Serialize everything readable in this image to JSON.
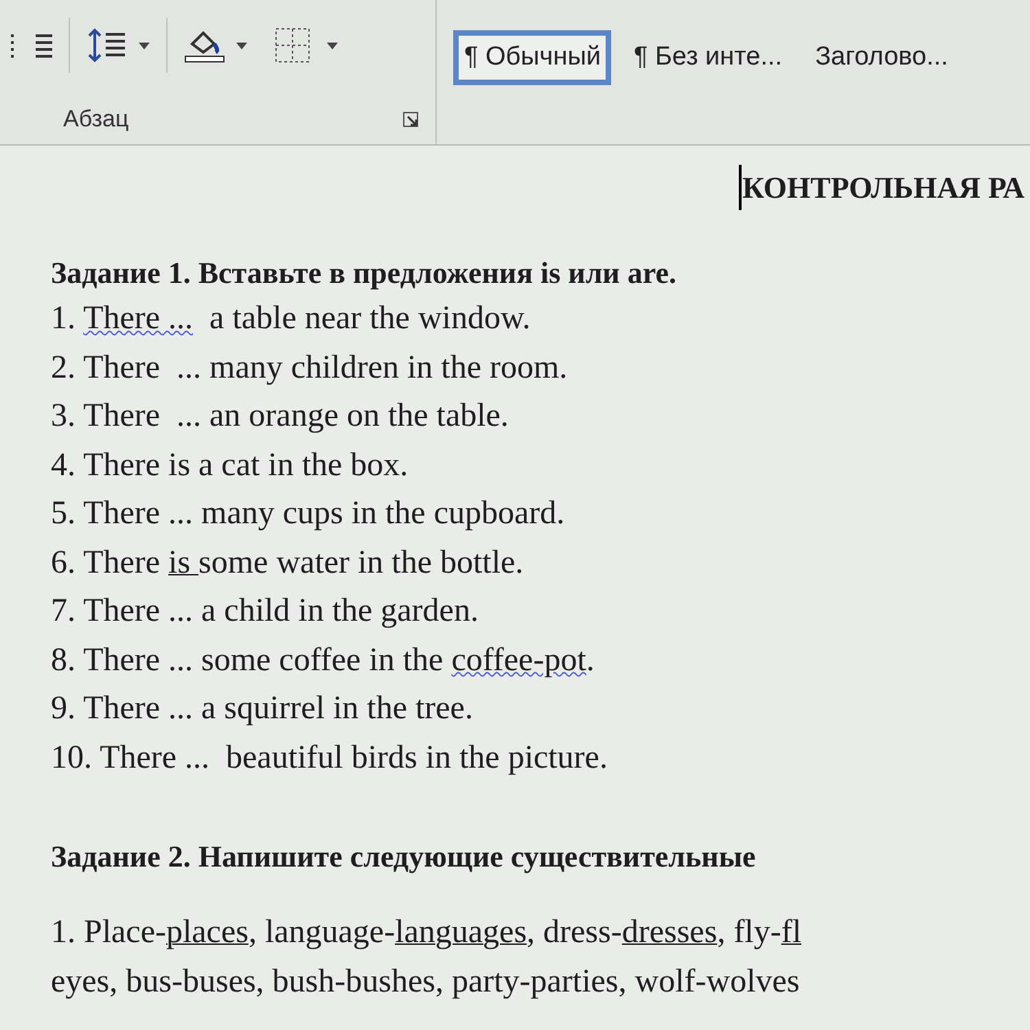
{
  "ribbon": {
    "paragraph_group": {
      "label": "Абзац"
    },
    "styles": [
      {
        "label": "¶ Обычный",
        "selected": true
      },
      {
        "label": "¶ Без инте...",
        "selected": false
      },
      {
        "label": "Заголово...",
        "selected": false
      }
    ]
  },
  "document": {
    "title": "КОНТРОЛЬНАЯ РА",
    "tasks": [
      {
        "heading": "Задание 1. Вставьте в предложения is или are.",
        "lines": [
          [
            {
              "text": "1. "
            },
            {
              "text": "There ...",
              "kind": "misspelled"
            },
            {
              "text": "  a table near the window."
            }
          ],
          [
            {
              "text": "2. There  ... many children in the room."
            }
          ],
          [
            {
              "text": "3. There  ... an orange on the table."
            }
          ],
          [
            {
              "text": "4. There is a cat in the box."
            }
          ],
          [
            {
              "text": "5. There ... many cups in the cupboard."
            }
          ],
          [
            {
              "text": "6. There "
            },
            {
              "text": "is ",
              "kind": "underlined"
            },
            {
              "text": "some water in the bottle."
            }
          ],
          [
            {
              "text": "7. There ... a child in the garden."
            }
          ],
          [
            {
              "text": "8. There ... some coffee in the "
            },
            {
              "text": "coffee-pot",
              "kind": "misspelled"
            },
            {
              "text": "."
            }
          ],
          [
            {
              "text": "9. There ... a squirrel in the tree."
            }
          ],
          [
            {
              "text": "10. There ...  beautiful birds in the picture."
            }
          ]
        ]
      },
      {
        "heading": "Задание 2. Напишите следующие существительные",
        "lines": [
          [
            {
              "text": "1. Place-"
            },
            {
              "text": "places",
              "kind": "underlined"
            },
            {
              "text": ", language-"
            },
            {
              "text": "languages",
              "kind": "underlined"
            },
            {
              "text": ", dress-"
            },
            {
              "text": "dresses",
              "kind": "underlined"
            },
            {
              "text": ", fly-"
            },
            {
              "text": "fl",
              "kind": "underlined"
            }
          ],
          [
            {
              "text": "eyes, bus-buses, bush-bushes, party-parties, wolf-wolves"
            }
          ]
        ]
      }
    ]
  }
}
